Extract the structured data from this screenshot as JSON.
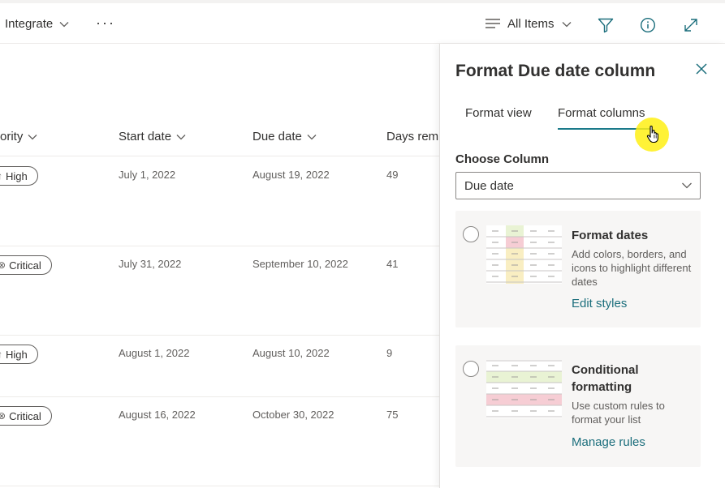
{
  "toolbar": {
    "integrate_label": "Integrate",
    "more_label": "···",
    "view_label": "All Items"
  },
  "list": {
    "columns": [
      {
        "label": "ority"
      },
      {
        "label": "Start date"
      },
      {
        "label": "Due date"
      },
      {
        "label": "Days rem"
      }
    ],
    "rows": [
      {
        "priority": "High",
        "priority_icon": "arrow-up-icon",
        "start": "July 1, 2022",
        "due": "August 19, 2022",
        "days": "49"
      },
      {
        "priority": "Critical",
        "priority_icon": "x-circle-icon",
        "start": "July 31, 2022",
        "due": "September 10, 2022",
        "days": "41"
      },
      {
        "priority": "High",
        "priority_icon": "arrow-up-icon",
        "start": "August 1, 2022",
        "due": "August 10, 2022",
        "days": "9"
      },
      {
        "priority": "Critical",
        "priority_icon": "x-circle-icon",
        "start": "August 16, 2022",
        "due": "October 30, 2022",
        "days": "75"
      }
    ]
  },
  "panel": {
    "title": "Format Due date column",
    "tabs": [
      {
        "label": "Format view"
      },
      {
        "label": "Format columns"
      }
    ],
    "choose_label": "Choose Column",
    "dropdown_value": "Due date",
    "cards": [
      {
        "title": "Format dates",
        "description": "Add colors, borders, and icons to highlight different dates",
        "link": "Edit styles"
      },
      {
        "title": "Conditional formatting",
        "description": "Use custom rules to format your list",
        "link": "Manage rules"
      }
    ]
  },
  "colors": {
    "accent": "#1b7a8a",
    "link": "#1b6e7c",
    "highlight_green": "#e9f3d4",
    "highlight_red": "#f6cdd4",
    "highlight_yellow": "#f9eec2",
    "cursor_halo": "#fff014"
  }
}
